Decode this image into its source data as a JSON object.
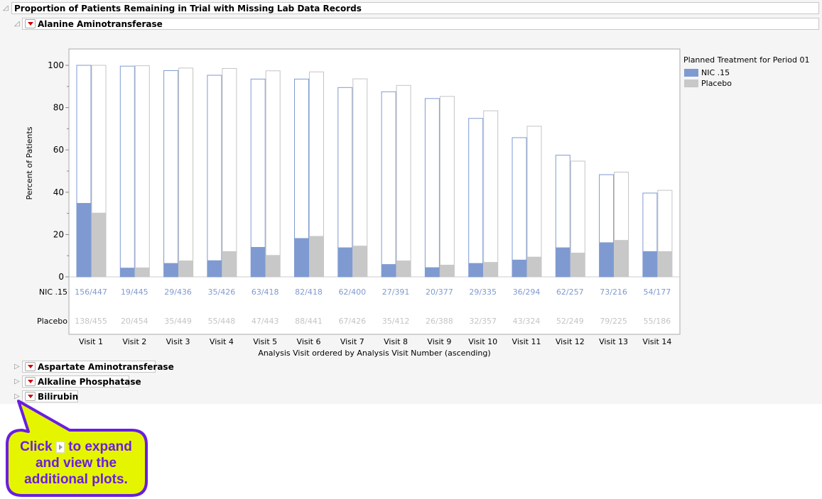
{
  "report": {
    "title": "Proportion of Patients Remaining in Trial with Missing Lab Data Records"
  },
  "sections": [
    {
      "label": "Alanine Aminotransferase",
      "expanded": true
    },
    {
      "label": "Aspartate Aminotransferase",
      "expanded": false
    },
    {
      "label": "Alkaline Phosphatase",
      "expanded": false
    },
    {
      "label": "Bilirubin",
      "expanded": false
    }
  ],
  "callout": {
    "before": "Click",
    "after": "to expand and view the additional plots.",
    "bg": "#e5f500",
    "border": "#6a1ee0"
  },
  "chart_data": {
    "type": "bar",
    "xlabel": "Analysis Visit ordered by Analysis Visit Number (ascending)",
    "ylabel": "Percent of Patients",
    "ylim": [
      0,
      100
    ],
    "yticks": [
      0,
      20,
      40,
      60,
      80,
      100
    ],
    "categories": [
      "Visit 1",
      "Visit 2",
      "Visit 3",
      "Visit 4",
      "Visit 5",
      "Visit 6",
      "Visit 7",
      "Visit 8",
      "Visit 9",
      "Visit 10",
      "Visit 11",
      "Visit 12",
      "Visit 13",
      "Visit 14"
    ],
    "legend": {
      "title": "Planned Treatment for Period 01",
      "placement": "right"
    },
    "series": [
      {
        "name": "NIC .15",
        "color": "#7f9ad1",
        "remaining_pct": [
          100,
          99.6,
          97.5,
          95.3,
          93.5,
          93.5,
          89.5,
          87.5,
          84.3,
          74.9,
          65.8,
          57.5,
          48.3,
          39.6
        ],
        "missing_pct": [
          34.9,
          4.3,
          6.5,
          7.8,
          14.1,
          18.3,
          13.9,
          6.0,
          4.5,
          6.5,
          8.1,
          13.9,
          16.3,
          12.1
        ],
        "counts": [
          "156/447",
          "19/445",
          "29/436",
          "35/426",
          "63/418",
          "82/418",
          "62/400",
          "27/391",
          "20/377",
          "29/335",
          "36/294",
          "62/257",
          "73/216",
          "54/177"
        ]
      },
      {
        "name": "Placebo",
        "color": "#c8c8c8",
        "remaining_pct": [
          100,
          99.8,
          98.7,
          98.5,
          97.4,
          96.9,
          93.6,
          90.5,
          85.3,
          78.5,
          71.2,
          54.7,
          49.5,
          40.9
        ],
        "missing_pct": [
          30.3,
          4.4,
          7.7,
          12.1,
          10.3,
          19.3,
          14.7,
          7.7,
          5.7,
          7.0,
          9.5,
          11.4,
          17.4,
          12.1
        ],
        "counts": [
          "138/455",
          "20/454",
          "35/449",
          "55/448",
          "47/443",
          "88/441",
          "67/426",
          "35/412",
          "26/388",
          "32/357",
          "43/324",
          "52/249",
          "79/225",
          "55/186"
        ]
      }
    ]
  }
}
